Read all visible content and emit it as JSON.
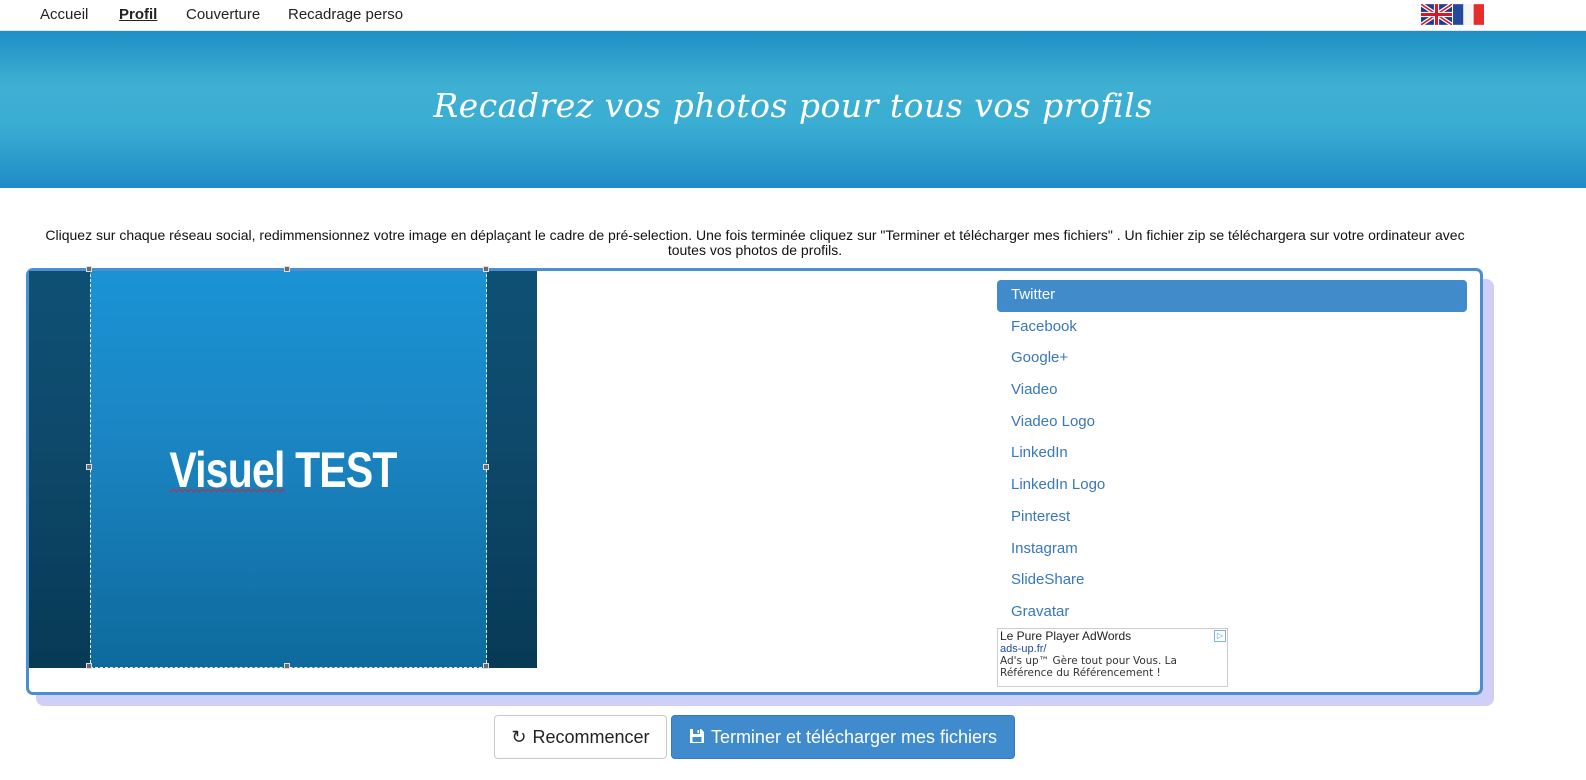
{
  "nav": {
    "items": [
      {
        "label": "Accueil"
      },
      {
        "label": "Profil"
      },
      {
        "label": "Couverture"
      },
      {
        "label": "Recadrage perso"
      }
    ],
    "active_index": 1
  },
  "banner": {
    "title": "Recadrez vos photos pour tous vos profils"
  },
  "instructions": {
    "text": "Cliquez sur chaque réseau social, redimmensionnez votre image en déplaçant le cadre de pré-selection. Une fois terminée cliquez sur \"Terminer et télécharger mes fichiers\" . Un fichier zip se téléchargera sur votre ordinateur avec toutes vos photos de profils."
  },
  "crop": {
    "image_text_part1": "Visuel",
    "image_text_part2": " TEST"
  },
  "social": {
    "items": [
      {
        "label": "Twitter"
      },
      {
        "label": "Facebook"
      },
      {
        "label": "Google+"
      },
      {
        "label": "Viadeo"
      },
      {
        "label": "Viadeo Logo"
      },
      {
        "label": "LinkedIn"
      },
      {
        "label": "LinkedIn Logo"
      },
      {
        "label": "Pinterest"
      },
      {
        "label": "Instagram"
      },
      {
        "label": "SlideShare"
      },
      {
        "label": "Gravatar"
      }
    ],
    "active_index": 0
  },
  "ad": {
    "title": "Le Pure Player AdWords",
    "url": "ads-up.fr/",
    "text": "Ad's up™ Gère tout pour Vous. La Référence du Référencement !"
  },
  "buttons": {
    "restart_label": "Recommencer",
    "finish_label": "Terminer et télécharger mes fichiers"
  },
  "colors": {
    "accent": "#418bcb",
    "banner": "#3aadd3",
    "link": "#3877bb"
  }
}
